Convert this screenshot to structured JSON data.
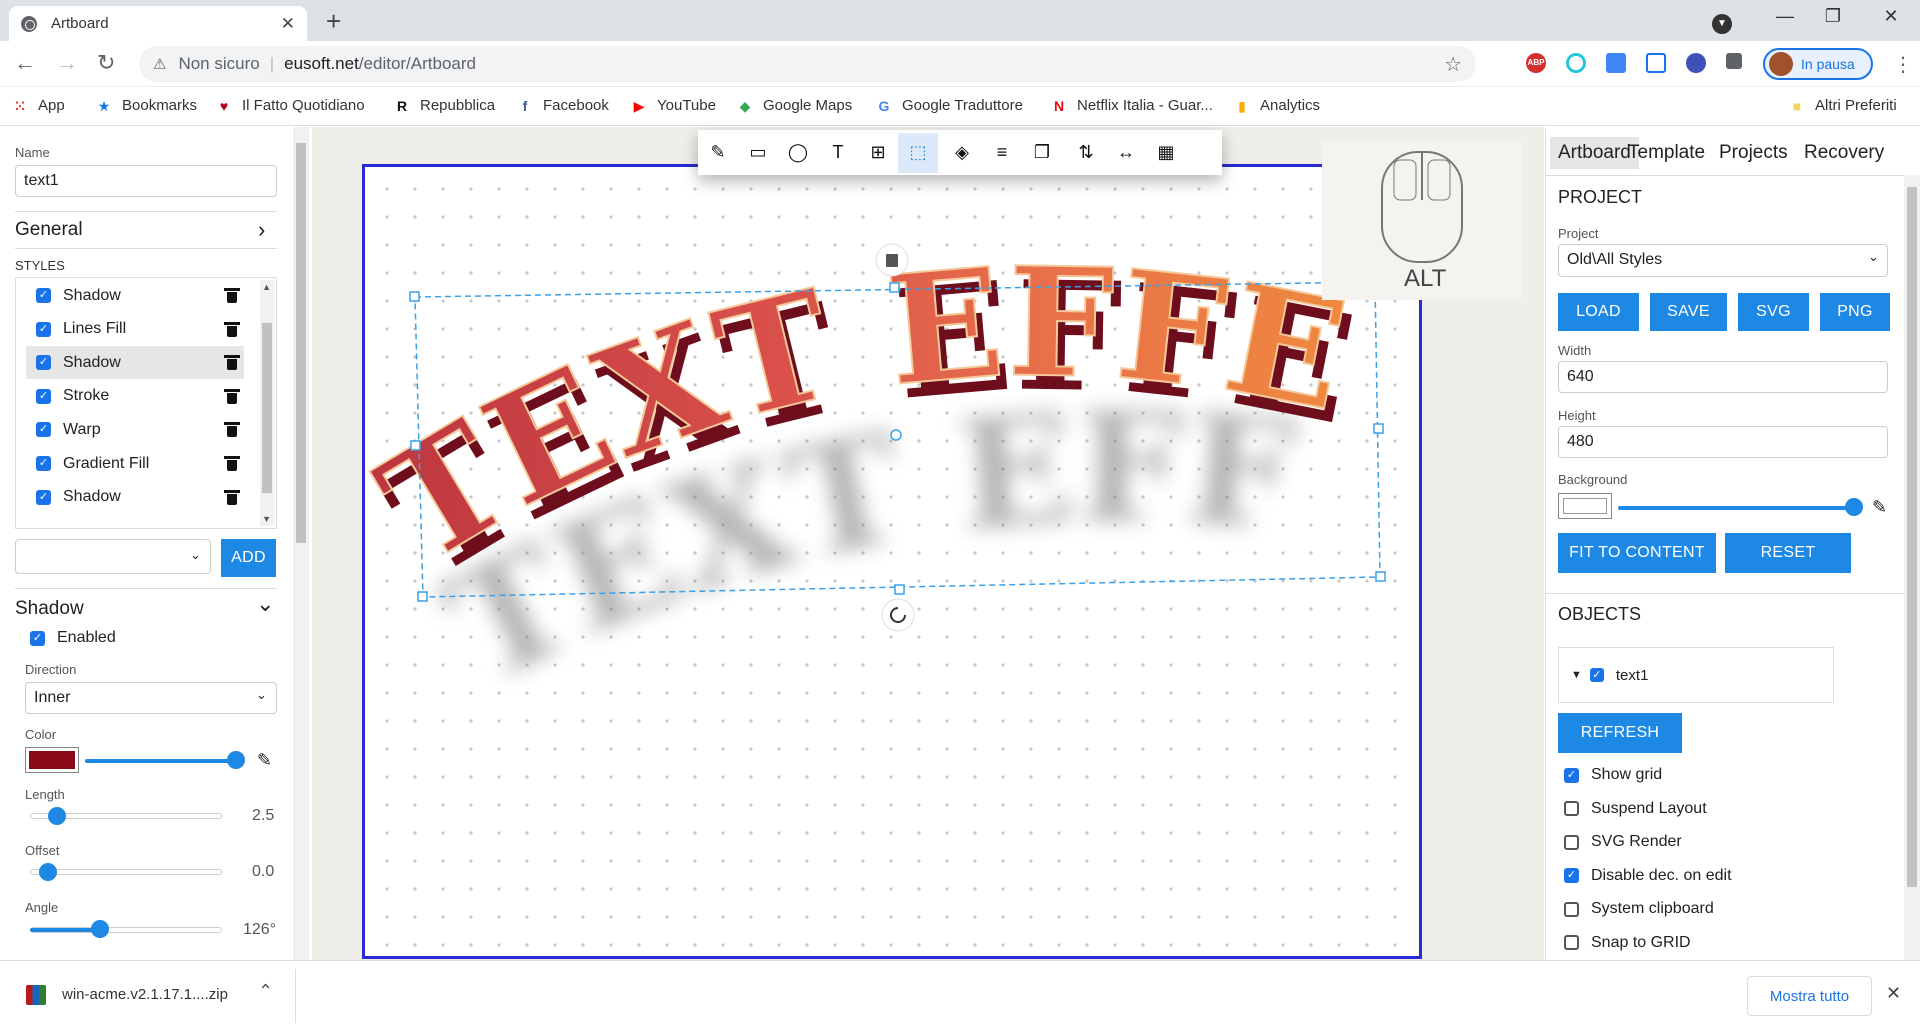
{
  "browser": {
    "tab_title": "Artboard",
    "security_label": "Non sicuro",
    "url_domain": "eusoft.net",
    "url_path": "/editor/Artboard",
    "profile_label": "In pausa"
  },
  "bookmarks": [
    {
      "label": "App",
      "icon": "apps-grid-icon",
      "color": "#ea4335"
    },
    {
      "label": "Bookmarks",
      "icon": "star-icon",
      "color": "#1a73e8"
    },
    {
      "label": "Il Fatto Quotidiano",
      "icon": "ilfatto-icon",
      "color": "#b00020"
    },
    {
      "label": "Repubblica",
      "icon": "repubblica-icon",
      "color": "#111111"
    },
    {
      "label": "Facebook",
      "icon": "facebook-icon",
      "color": "#3b5998"
    },
    {
      "label": "YouTube",
      "icon": "youtube-icon",
      "color": "#ff0000"
    },
    {
      "label": "Google Maps",
      "icon": "maps-icon",
      "color": "#34a853"
    },
    {
      "label": "Google Traduttore",
      "icon": "translate-icon",
      "color": "#4285f4"
    },
    {
      "label": "Netflix Italia - Guar...",
      "icon": "netflix-icon",
      "color": "#e50914"
    },
    {
      "label": "Analytics",
      "icon": "analytics-icon",
      "color": "#f9ab00"
    },
    {
      "label": "Altri Preferiti",
      "icon": "folder-icon",
      "color": "#f6d365"
    }
  ],
  "left": {
    "name_label": "Name",
    "name_value": "text1",
    "general_label": "General",
    "styles_label": "STYLES",
    "styles": [
      {
        "label": "Shadow",
        "checked": true,
        "selected": false
      },
      {
        "label": "Lines Fill",
        "checked": true,
        "selected": false
      },
      {
        "label": "Shadow",
        "checked": true,
        "selected": true
      },
      {
        "label": "Stroke",
        "checked": true,
        "selected": false
      },
      {
        "label": "Warp",
        "checked": true,
        "selected": false
      },
      {
        "label": "Gradient Fill",
        "checked": true,
        "selected": false
      },
      {
        "label": "Shadow",
        "checked": true,
        "selected": false
      }
    ],
    "add_select_value": "",
    "add_label": "ADD",
    "shadow_section": "Shadow",
    "enabled_label": "Enabled",
    "direction_label": "Direction",
    "direction_value": "Inner",
    "color_label": "Color",
    "color_value": "#8b0a1a",
    "length_label": "Length",
    "length_value": "2.5",
    "length_fraction": 0.1,
    "offset_label": "Offset",
    "offset_value": "0.0",
    "offset_fraction": 0.05,
    "angle_label": "Angle",
    "angle_value": "126°",
    "angle_fraction": 0.35
  },
  "canvas": {
    "artwork_text": "TEXT EFFECTS",
    "hint_label": "ALT",
    "tools": [
      "brush-icon",
      "rectangle-icon",
      "ellipse-icon",
      "text-icon",
      "frame-icon",
      "transform-icon",
      "fill-icon",
      "align-text-icon",
      "duplicate-icon",
      "bring-front-icon",
      "flip-horizontal-icon",
      "grid-icon"
    ]
  },
  "right": {
    "tabs": [
      "Artboard",
      "Template",
      "Projects",
      "Recovery"
    ],
    "project_heading": "PROJECT",
    "project_label": "Project",
    "project_value": "Old\\All Styles",
    "load": "LOAD",
    "save": "SAVE",
    "svg": "SVG",
    "png": "PNG",
    "width_label": "Width",
    "width_value": "640",
    "height_label": "Height",
    "height_value": "480",
    "background_label": "Background",
    "fit_label": "FIT TO CONTENT",
    "reset_label": "RESET",
    "objects_heading": "OBJECTS",
    "object_name": "text1",
    "refresh_label": "REFRESH",
    "options": [
      {
        "label": "Show grid",
        "checked": true
      },
      {
        "label": "Suspend Layout",
        "checked": false
      },
      {
        "label": "SVG Render",
        "checked": false
      },
      {
        "label": "Disable dec. on edit",
        "checked": true
      },
      {
        "label": "System clipboard",
        "checked": false
      },
      {
        "label": "Snap to GRID",
        "checked": false
      }
    ]
  },
  "download": {
    "filename": "win-acme.v2.1.17.1....zip",
    "show_all": "Mostra tutto"
  }
}
